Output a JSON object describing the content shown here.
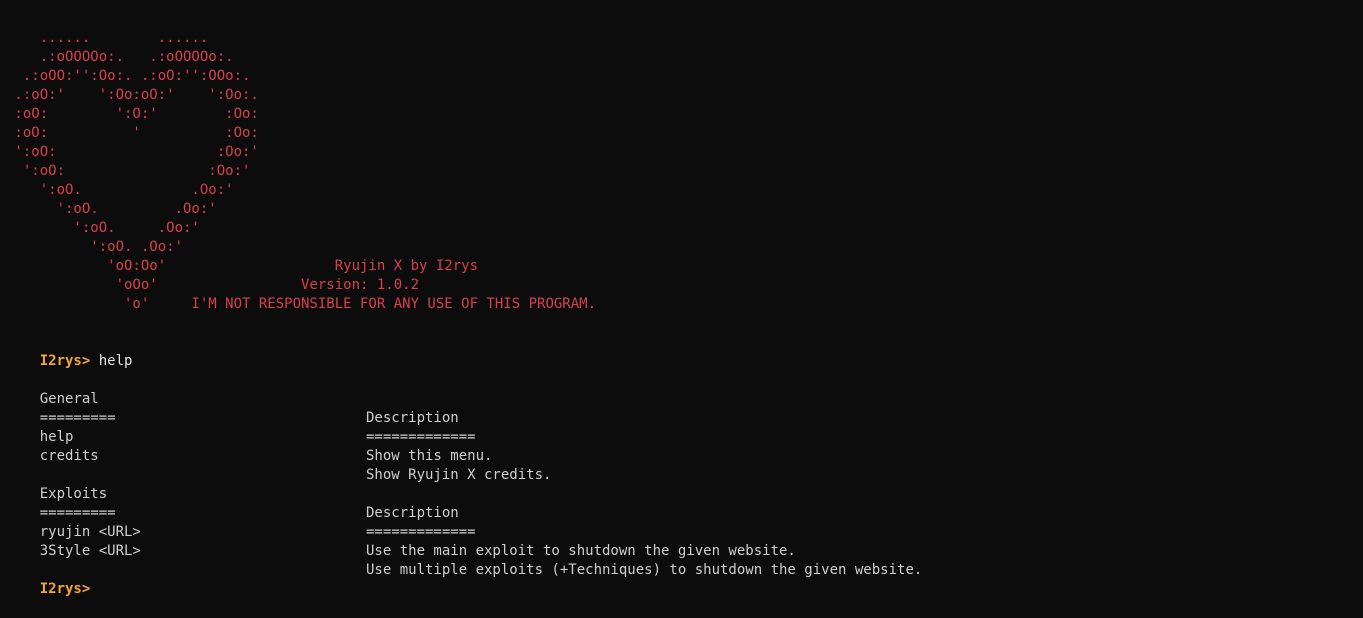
{
  "ascii_art": [
    "    ......        ......",
    "    .:oOOOOo:.   .:oOOOOo:.",
    "  .:oOO:'':Oo:. .:oO:'':OOo:.",
    " .:oO:'    ':Oo:oO:'    ':Oo:.",
    " :oO:        ':O:'        :Oo:",
    " :oO:          '          :Oo:",
    " ':oO:                   :Oo:'",
    "  ':oO:                 :Oo:'",
    "    ':oO.             .Oo:'",
    "      ':oO.         .Oo:'",
    "        ':oO.     .Oo:'",
    "          ':oO. .Oo:'",
    "            'oO:Oo'                    Ryujin X by I2rys",
    "             'oOo'                 Version: 1.0.2",
    "              'o'     I'M NOT RESPONSIBLE FOR ANY USE OF THIS PROGRAM."
  ],
  "session": {
    "prompt": "I2rys>",
    "command": " help"
  },
  "general": {
    "header": "General",
    "header_rule": "=========",
    "desc_header": "Description",
    "desc_rule": "=============",
    "rows": [
      {
        "name": "help",
        "desc": "Show this menu."
      },
      {
        "name": "credits",
        "desc": "Show Ryujin X credits."
      }
    ]
  },
  "exploits": {
    "header": "Exploits",
    "header_rule": "=========",
    "desc_header": "Description",
    "desc_rule": "=============",
    "rows": [
      {
        "name": "ryujin <URL>",
        "desc": "Use the main exploit to shutdown the given website."
      },
      {
        "name": "3Style <URL>",
        "desc": "Use multiple exploits (+Techniques) to shutdown the given website."
      }
    ]
  },
  "final_prompt": "I2rys>",
  "colors": {
    "background": "#0c0c0c",
    "art": "#d7404e",
    "prompt": "#f2a53a",
    "text": "#cfcfcf"
  }
}
